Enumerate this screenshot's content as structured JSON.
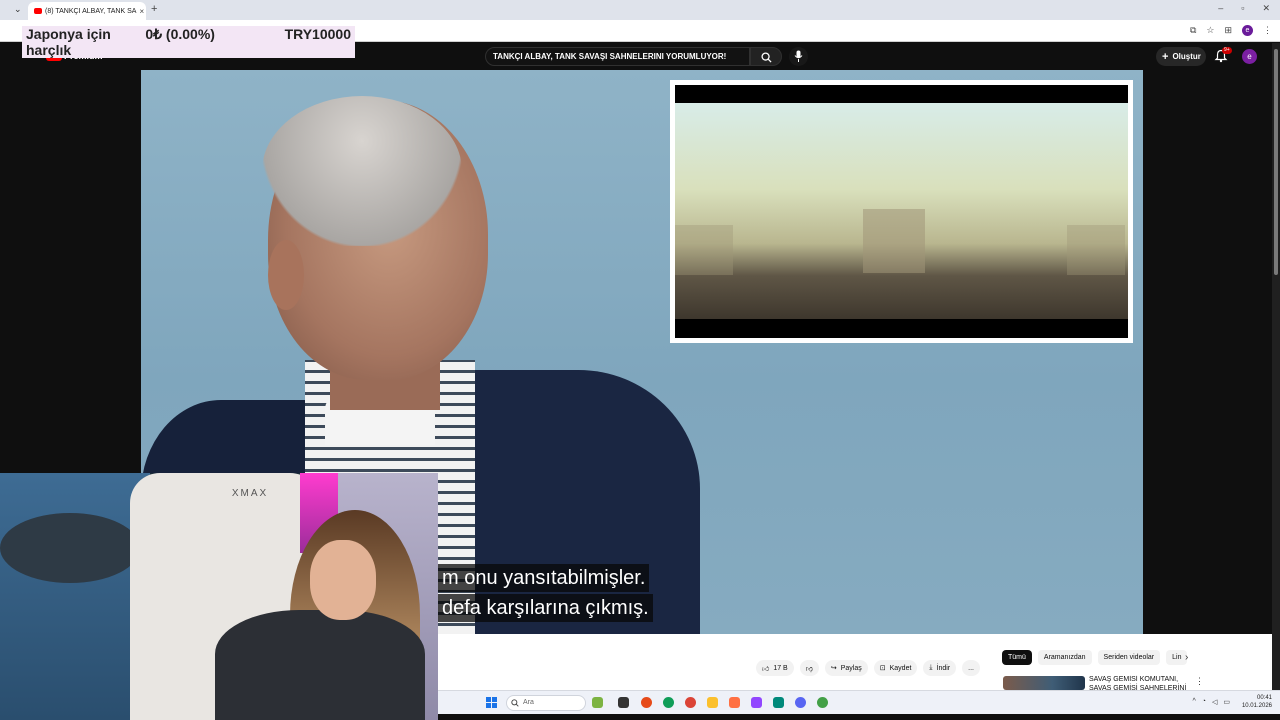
{
  "browser": {
    "tab_title": "(8) TANKÇI ALBAY, TANK SA",
    "new_tab_symbol": "+",
    "tab_close_symbol": "×"
  },
  "ticker": {
    "name": "Japonya için harçlık",
    "change": "0₺ (0.00%)",
    "value": "TRY10000"
  },
  "youtube": {
    "logo_text": "Premium",
    "search_value": "TANKÇI ALBAY, TANK SAVAŞI SAHNELERINI YORUMLUYOR!",
    "create_label": "Oluştur",
    "notifications_badge": "9+",
    "avatar_letter": "e"
  },
  "video": {
    "subtitle_line1": "m onu yansıtabilmişler.",
    "subtitle_line2": "defa karşılarına çıkmış.",
    "webcam_chair_brand": "XMAX"
  },
  "actions": {
    "like_count": "17 B",
    "share": "Paylaş",
    "save": "Kaydet",
    "download": "İndir",
    "more": "..."
  },
  "chips": [
    {
      "label": "Tümü",
      "active": true
    },
    {
      "label": "Aramanızdan",
      "active": false
    },
    {
      "label": "Seriden videolar",
      "active": false
    },
    {
      "label": "Lin",
      "active": false
    }
  ],
  "recommendation": {
    "title": "SAVAŞ GEMİSİ KOMUTANI, SAVAŞ GEMİSİ SAHNELERİNİ"
  },
  "taskbar": {
    "search_placeholder": "Ara",
    "time": "00:41",
    "date": "10.01.2026"
  },
  "colors": {
    "youtube_red": "#ff0000",
    "dark_bg": "#0f0f0f",
    "ticker_bg": "#f3e6f5"
  }
}
